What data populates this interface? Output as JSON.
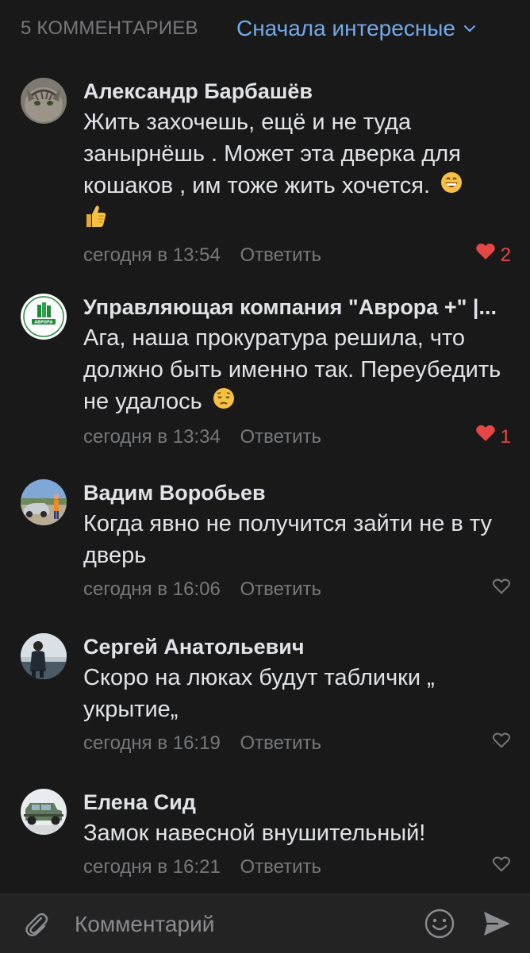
{
  "header": {
    "count_label": "5 КОММЕНТАРИЕВ",
    "sort_label": "Сначала интересные"
  },
  "comments": [
    {
      "author": "Александр Барбашёв",
      "text": "Жить захочешь, ещё и не туда занырнёшь . Может эта дверка для кошаков , им тоже жить хочется.",
      "time": "сегодня в 13:54",
      "reply": "Ответить",
      "likes": "2",
      "liked": true,
      "emoji": [
        "grinning-face",
        "thumbs-up"
      ]
    },
    {
      "author": "Управляющая компания \"Аврора +\" |...",
      "text": "Ага, наша прокуратура решила, что должно быть именно так. Переубедить не удалось",
      "time": "сегодня в 13:34",
      "reply": "Ответить",
      "likes": "1",
      "liked": true,
      "emoji": [
        "pensive-face"
      ],
      "avatar_text": "АВРОРА"
    },
    {
      "author": "Вадим Воробьев",
      "text": "Когда явно не получится зайти не в ту дверь",
      "time": "сегодня в 16:06",
      "reply": "Ответить",
      "liked": false
    },
    {
      "author": "Сергей Анатольевич",
      "text": "Скоро на люках будут таблички „ укрытие„",
      "time": "сегодня в 16:19",
      "reply": "Ответить",
      "liked": false
    },
    {
      "author": "Елена Сид",
      "text": "Замок навесной внушительный!",
      "time": "сегодня в 16:21",
      "reply": "Ответить",
      "liked": false
    }
  ],
  "composer": {
    "placeholder": "Комментарий"
  },
  "colors": {
    "background": "#19191a",
    "accent": "#71aaeb",
    "like": "#e64646",
    "secondary_text": "#76787a"
  }
}
